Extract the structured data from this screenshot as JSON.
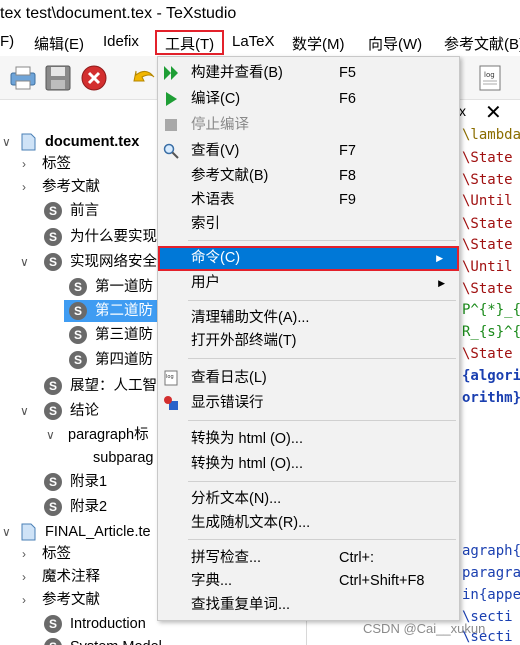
{
  "window": {
    "title": "tex test\\document.tex - TeXstudio"
  },
  "menubar": {
    "items": [
      "F)",
      "编辑(E)",
      "Idefix",
      "工具(T)",
      "LaTeX",
      "数学(M)",
      "向导(W)",
      "参考文献(B)"
    ]
  },
  "toolbar": {
    "icons": [
      "print-icon",
      "save-icon",
      "close-icon",
      "undo-icon",
      "log-icon"
    ]
  },
  "structure": {
    "rows": [
      {
        "label": "document.tex",
        "bold": true
      },
      {
        "label": "标签"
      },
      {
        "label": "参考文献"
      },
      {
        "label": "前言"
      },
      {
        "label": "为什么要实现"
      },
      {
        "label": "实现网络安全"
      },
      {
        "label": "第一道防"
      },
      {
        "label": "第二道防"
      },
      {
        "label": "第三道防"
      },
      {
        "label": "第四道防"
      },
      {
        "label": "展望：人工智"
      },
      {
        "label": "结论"
      },
      {
        "label": "paragraph标"
      },
      {
        "label": "subparag"
      },
      {
        "label": "附录1"
      },
      {
        "label": "附录2"
      },
      {
        "label": "FINAL_Article.te"
      },
      {
        "label": "标签"
      },
      {
        "label": "魔术注释"
      },
      {
        "label": "参考文献"
      },
      {
        "label": "Introduction"
      },
      {
        "label": "System Model"
      }
    ]
  },
  "editor": {
    "tab_suffix": "x",
    "lines": [
      "\\lambda",
      "\\State",
      "\\State",
      "\\Until",
      "\\State",
      "\\State",
      "\\Until",
      "\\State",
      "P^{*}_{",
      "R_{s}^{",
      "\\State",
      "{algori",
      "orithm}",
      "agraph{",
      "paragra",
      "in{appe",
      "\\secti",
      "\\secti"
    ]
  },
  "tools_menu": {
    "items": [
      {
        "label": "构建并查看(B)",
        "shortcut": "F5"
      },
      {
        "label": "编译(C)",
        "shortcut": "F6"
      },
      {
        "label": "停止编译",
        "shortcut": ""
      },
      {
        "label": "查看(V)",
        "shortcut": "F7"
      },
      {
        "label": "参考文献(B)",
        "shortcut": "F8"
      },
      {
        "label": "术语表",
        "shortcut": "F9"
      },
      {
        "label": "索引",
        "shortcut": ""
      },
      {
        "label": "命令(C)",
        "shortcut": ""
      },
      {
        "label": "用户",
        "shortcut": ""
      },
      {
        "label": "清理辅助文件(A)...",
        "shortcut": ""
      },
      {
        "label": "打开外部终端(T)",
        "shortcut": ""
      },
      {
        "label": "查看日志(L)",
        "shortcut": ""
      },
      {
        "label": "显示错误行",
        "shortcut": ""
      },
      {
        "label": "转换为 html (O)...",
        "shortcut": ""
      },
      {
        "label": "转换为 html (O)...",
        "shortcut": ""
      },
      {
        "label": "分析文本(N)...",
        "shortcut": ""
      },
      {
        "label": "生成随机文本(R)...",
        "shortcut": ""
      },
      {
        "label": "拼写检查...",
        "shortcut": "Ctrl+:"
      },
      {
        "label": "字典...",
        "shortcut": "Ctrl+Shift+F8"
      },
      {
        "label": "查找重复单词...",
        "shortcut": ""
      }
    ]
  },
  "watermark": "CSDN @Cai__xukun",
  "colors": {
    "highlight": "#0078d7",
    "annotation_red": "#e3212b",
    "selected_tree": "#3f9cf2"
  }
}
